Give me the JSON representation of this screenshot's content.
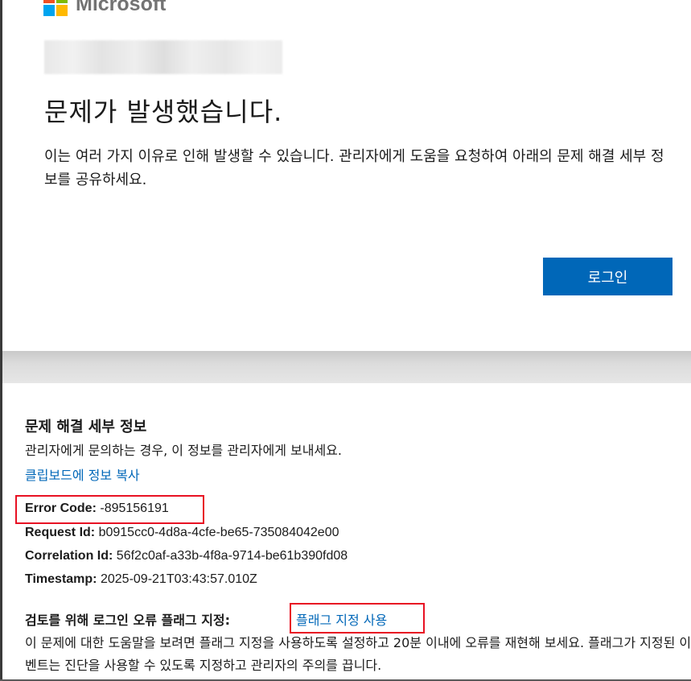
{
  "brand": {
    "name": "Microsoft"
  },
  "colors": {
    "logo_red": "#f25022",
    "logo_green": "#7fba00",
    "logo_blue": "#00a4ef",
    "logo_yellow": "#ffb900",
    "primary_button": "#0067b8",
    "link": "#0067b8",
    "highlight_box": "#e81123"
  },
  "error_page": {
    "title": "문제가 발생했습니다.",
    "description": "이는 여러 가지 이유로 인해 발생할 수 있습니다. 관리자에게 도움을 요청하여 아래의 문제 해결 세부 정보를 공유하세요.",
    "signin_button": "로그인"
  },
  "troubleshooting": {
    "title": "문제 해결 세부 정보",
    "subtitle": "관리자에게 문의하는 경우, 이 정보를 관리자에게 보내세요.",
    "copy_link": "클립보드에 정보 복사",
    "fields": [
      {
        "label": "Error Code:",
        "value": "-895156191"
      },
      {
        "label": "Request Id:",
        "value": "b0915cc0-4d8a-4cfe-be65-735084042e00"
      },
      {
        "label": "Correlation Id:",
        "value": "56f2c0af-a33b-4f8a-9714-be61b390fd08"
      },
      {
        "label": "Timestamp:",
        "value": "2025-09-21T03:43:57.010Z"
      }
    ],
    "flag_label": "검토를 위해 로그인 오류 플래그 지정:",
    "flag_link": "플래그 지정 사용",
    "flag_description": "이 문제에 대한 도움말을 보려면 플래그 지정을 사용하도록 설정하고 20분 이내에 오류를 재현해 보세요. 플래그가 지정된 이벤트는 진단을 사용할 수 있도록 지정하고 관리자의 주의를 끕니다."
  }
}
